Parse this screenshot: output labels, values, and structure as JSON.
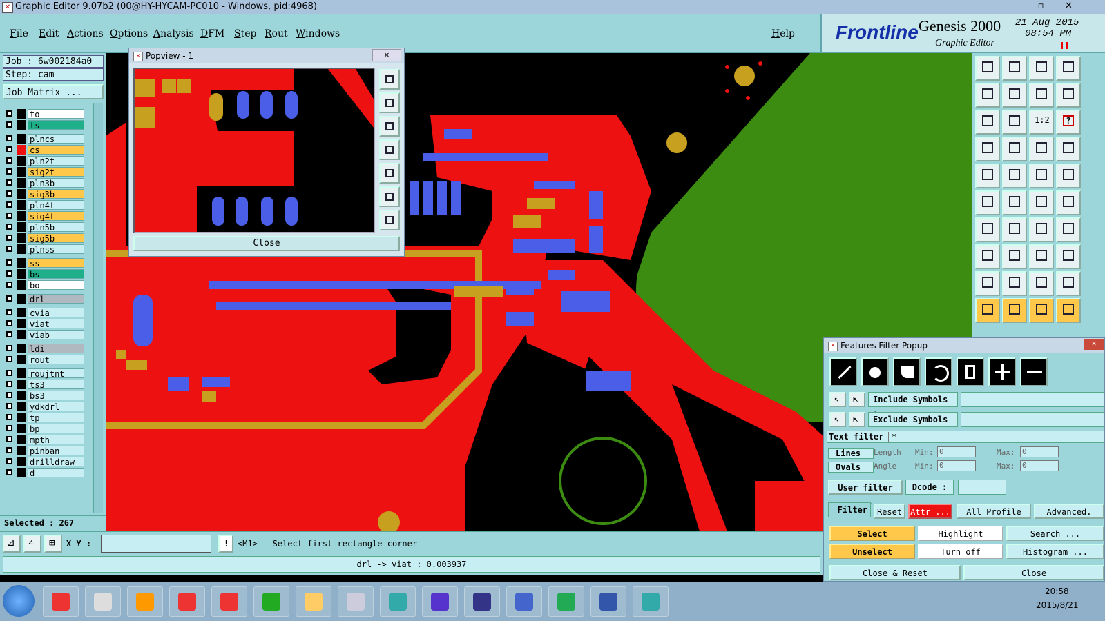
{
  "window": {
    "title": "Graphic Editor 9.07b2 (00@HY-HYCAM-PC010 - Windows, pid:4968)",
    "min": "–",
    "max": "▫",
    "close": "✕"
  },
  "menu": [
    "File",
    "Edit",
    "Actions",
    "Options",
    "Analysis",
    "DFM",
    "Step",
    "Rout",
    "Windows"
  ],
  "help": "Help",
  "brand": {
    "logo": "Frontline",
    "product": "Genesis 2000",
    "subtitle": "Graphic Editor",
    "date": "21 Aug 2015",
    "time": "08:54 PM"
  },
  "job": {
    "job_label": "Job : 6w002184a0",
    "step_label": "Step: cam",
    "matrix_button": "Job Matrix ..."
  },
  "layers": [
    {
      "name": "to",
      "color": "#ffffff"
    },
    {
      "name": "ts",
      "color": "#1fb08a"
    },
    {
      "name": "plncs",
      "color": "#c7eef2"
    },
    {
      "name": "cs",
      "color": "#ffc84a"
    },
    {
      "name": "pln2t",
      "color": "#c7eef2"
    },
    {
      "name": "sig2t",
      "color": "#ffc84a"
    },
    {
      "name": "pln3b",
      "color": "#c7eef2"
    },
    {
      "name": "sig3b",
      "color": "#ffc84a"
    },
    {
      "name": "pln4t",
      "color": "#c7eef2"
    },
    {
      "name": "sig4t",
      "color": "#ffc84a"
    },
    {
      "name": "pln5b",
      "color": "#c7eef2"
    },
    {
      "name": "sig5b",
      "color": "#ffc84a"
    },
    {
      "name": "plnss",
      "color": "#c7eef2"
    },
    {
      "name": "ss",
      "color": "#ffc84a"
    },
    {
      "name": "bs",
      "color": "#1fb08a"
    },
    {
      "name": "bo",
      "color": "#ffffff"
    },
    {
      "name": "drl",
      "color": "#b0b8c0"
    },
    {
      "name": "cvia",
      "color": "#c7eef2"
    },
    {
      "name": "viat",
      "color": "#c7eef2"
    },
    {
      "name": "viab",
      "color": "#c7eef2"
    },
    {
      "name": "ldi",
      "color": "#b0b8c0"
    },
    {
      "name": "rout",
      "color": "#c7eef2"
    },
    {
      "name": "roujtnt",
      "color": "#c7eef2"
    },
    {
      "name": "ts3",
      "color": "#c7eef2"
    },
    {
      "name": "bs3",
      "color": "#c7eef2"
    },
    {
      "name": "ydkdrl",
      "color": "#c7eef2"
    },
    {
      "name": "tp",
      "color": "#c7eef2"
    },
    {
      "name": "bp",
      "color": "#c7eef2"
    },
    {
      "name": "mpth",
      "color": "#c7eef2"
    },
    {
      "name": "pinban",
      "color": "#c7eef2"
    },
    {
      "name": "drilldraw",
      "color": "#c7eef2"
    },
    {
      "name": "d",
      "color": "#c7eef2"
    }
  ],
  "selected": "Selected : 267",
  "popview": {
    "title": "Popview - 1",
    "close_button": "Close"
  },
  "filter": {
    "title": "Features Filter Popup",
    "include_label": "Include Symbols :",
    "exclude_label": "Exclude Symbols :",
    "text_filter_label": "Text filter",
    "text_filter_value": "*",
    "lines": "Lines",
    "ovals": "Ovals",
    "length": "Length",
    "angle": "Angle",
    "min1": "Min:",
    "min2": "Min:",
    "max1": "Max:",
    "max2": "Max:",
    "min_length_value": "0",
    "max_length_value": "0",
    "min_angle_value": "0",
    "max_angle_value": "0",
    "user_filter": "User filter ...",
    "dcode": "Dcode :",
    "filter": "Filter",
    "reset": "Reset",
    "attr": "Attr ...",
    "all_profile": "All Profile",
    "advanced": "Advanced.",
    "select": "Select",
    "highlight": "Highlight",
    "search": "Search ...",
    "unselect": "Unselect",
    "turn_off": "Turn off",
    "histogram": "Histogram ...",
    "close_reset": "Close & Reset",
    "close": "Close"
  },
  "status": {
    "xy_label": "X Y :",
    "prompt": "<M1> - Select first rectangle corner",
    "message": "drl -> viat : 0.003937"
  },
  "taskbar": {
    "time": "20:58",
    "date": "2015/8/21"
  },
  "tools": {
    "ratio": "1:2",
    "help": "?"
  }
}
